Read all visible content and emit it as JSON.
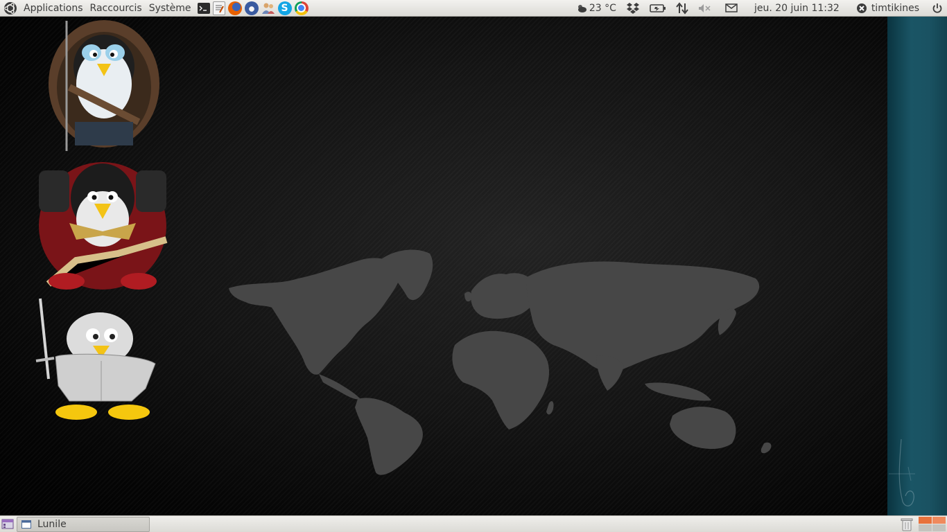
{
  "top_panel": {
    "menus": [
      "Applications",
      "Raccourcis",
      "Système"
    ],
    "launchers": [
      {
        "name": "terminal-icon",
        "color": "#2b2b2b"
      },
      {
        "name": "text-editor-icon",
        "color": "#e8e8e8"
      },
      {
        "name": "firefox-icon",
        "color": "#e66000"
      },
      {
        "name": "thunderbird-icon",
        "color": "#3a5ba0"
      },
      {
        "name": "contacts-icon",
        "color": "#8a9bb0"
      },
      {
        "name": "skype-icon",
        "color": "#12a5e4"
      },
      {
        "name": "chrome-icon",
        "color": "#db4437"
      }
    ],
    "weather": "23 °C",
    "clock": "jeu. 20 juin 11:32",
    "user": "timtikines"
  },
  "desktop": {
    "icons": [
      "penguin-ranger-icon",
      "penguin-space-marine-icon",
      "penguin-knight-icon"
    ]
  },
  "bottom_panel": {
    "window_button": "Lunile",
    "workspace_colors": [
      "#e8723c",
      "#f08a5d",
      "#c8c7c2",
      "#c8c7c2"
    ]
  }
}
